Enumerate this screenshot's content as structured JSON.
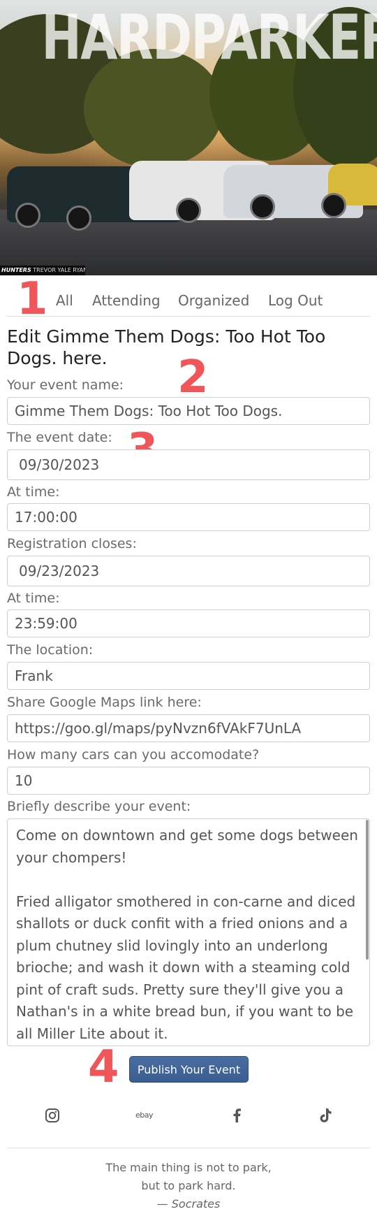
{
  "hero": {
    "title": "HARDPARKERS",
    "credit_brand": "HUNTERS",
    "credit_text": "TREVOR YALE RYAN"
  },
  "nav": {
    "items": [
      "All",
      "Attending",
      "Organized",
      "Log Out"
    ]
  },
  "annotations": {
    "m1": "1",
    "m2": "2",
    "m3": "3",
    "m4": "4"
  },
  "page": {
    "heading": "Edit Gimme Them Dogs: Too Hot Too Dogs. here."
  },
  "form": {
    "event_name_label": "Your event name:",
    "event_name_value": "Gimme Them Dogs: Too Hot Too Dogs.",
    "event_date_label": "The event date:",
    "event_date_value": "09/30/2023",
    "event_time_label": "At time:",
    "event_time_value": "17:00:00",
    "reg_close_label": "Registration closes:",
    "reg_close_value": "09/23/2023",
    "reg_time_label": "At time:",
    "reg_time_value": "23:59:00",
    "location_label": "The location:",
    "location_value": "Frank",
    "maps_label": "Share Google Maps link here:",
    "maps_value": "https://goo.gl/maps/pyNvzn6fVAkF7UnLA",
    "cars_label": "How many cars can you accomodate?",
    "cars_value": "10",
    "description_label": "Briefly describe your event:",
    "description_p1": "Come on downtown and get some dogs between your chompers!",
    "description_p2": "Fried alligator smothered in con-carne and diced shallots or duck confit with a fried onions and a plum chutney slid lovingly into an underlong brioche; and wash it down with a steaming cold pint of craft suds. Pretty sure they'll give you a Nathan's in a white bread bun, if you want to be all Miller Lite about it.",
    "publish_label": "Publish Your Event"
  },
  "footer": {
    "social": [
      "instagram-icon",
      "ebay-logo",
      "facebook-icon",
      "tiktok-icon"
    ],
    "ebay_text": "ebay",
    "quote_line1": "The main thing is not to park,",
    "quote_line2": "but to park hard.",
    "quote_dash": "— ",
    "quote_author": "Socrates"
  }
}
